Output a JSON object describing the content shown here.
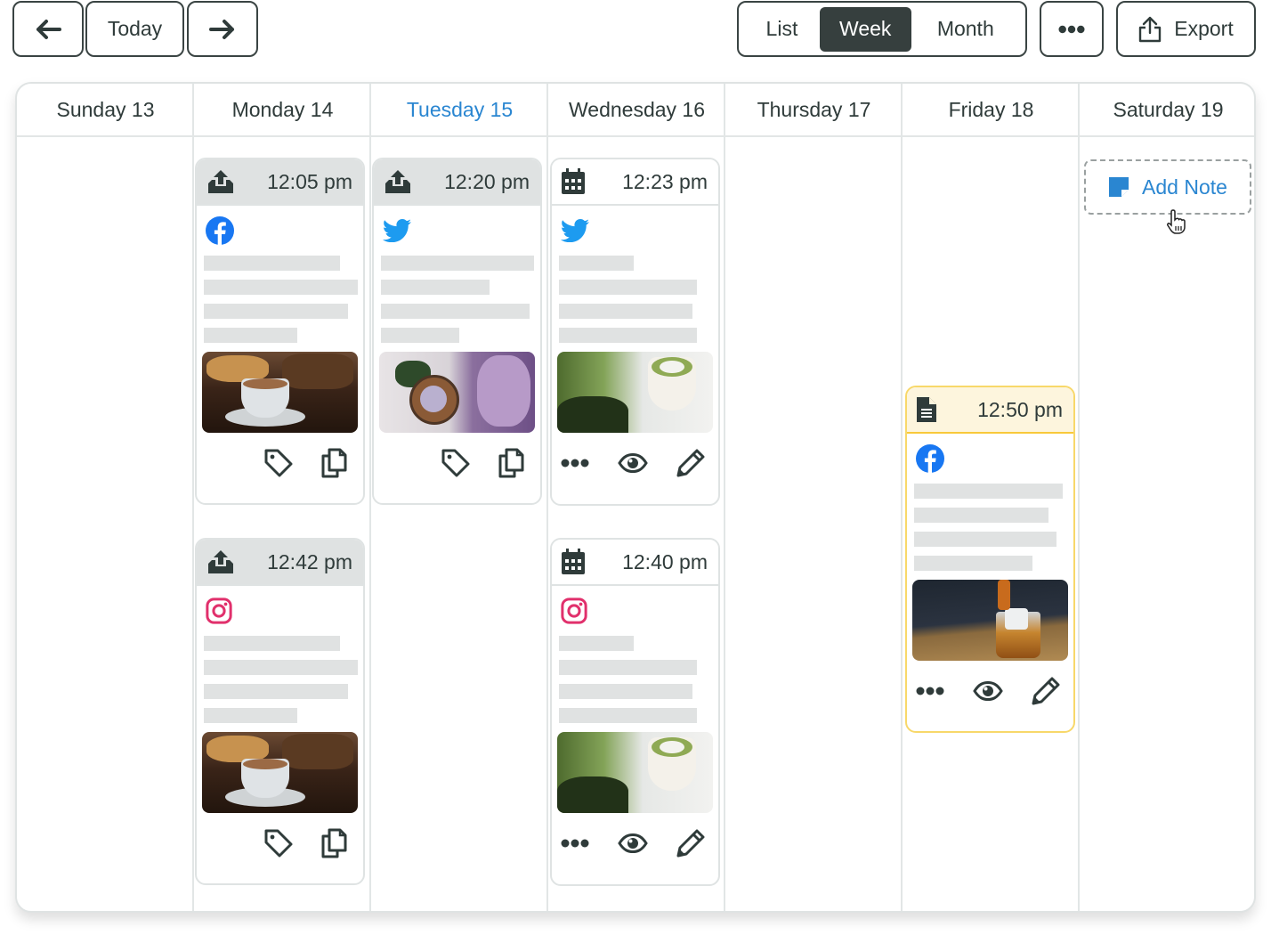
{
  "toolbar": {
    "prev_icon": "arrow-left-icon",
    "today_label": "Today",
    "next_icon": "arrow-right-icon",
    "views": [
      {
        "label": "List",
        "active": false
      },
      {
        "label": "Week",
        "active": true
      },
      {
        "label": "Month",
        "active": false
      }
    ],
    "more_icon": "ellipsis-icon",
    "export_label": "Export",
    "export_icon": "share-upload-icon"
  },
  "colors": {
    "accent": "#2a86d1",
    "dark": "#363f3e",
    "draft_border": "#f8c93a",
    "draft_header": "#fdf5dd",
    "published_header": "#dfe2e2",
    "facebook": "#1877f2",
    "twitter": "#1d9bf0",
    "instagram": "#e1306c"
  },
  "days": [
    {
      "label": "Sunday 13",
      "today": false
    },
    {
      "label": "Monday 14",
      "today": false
    },
    {
      "label": "Tuesday 15",
      "today": true
    },
    {
      "label": "Wednesday 16",
      "today": false
    },
    {
      "label": "Thursday 17",
      "today": false
    },
    {
      "label": "Friday 18",
      "today": false
    },
    {
      "label": "Saturday 19",
      "today": false
    }
  ],
  "posts": [
    {
      "day": "Monday 14",
      "time": "12:05 pm",
      "status": "published",
      "status_icon": "upload-tray-icon",
      "network": "facebook",
      "image": "cappuccino with pastries",
      "actions": [
        "tag",
        "copy"
      ]
    },
    {
      "day": "Monday 14",
      "time": "12:42 pm",
      "status": "published",
      "status_icon": "upload-tray-icon",
      "network": "instagram",
      "image": "cappuccino with pastries",
      "actions": [
        "tag",
        "copy"
      ]
    },
    {
      "day": "Tuesday 15",
      "time": "12:20 pm",
      "status": "published",
      "status_icon": "upload-tray-icon",
      "network": "twitter",
      "image": "lilac flowers and drink",
      "actions": [
        "tag",
        "copy"
      ]
    },
    {
      "day": "Wednesday 16",
      "time": "12:23 pm",
      "status": "scheduled",
      "status_icon": "calendar-icon",
      "network": "twitter",
      "image": "matcha latte with plant",
      "actions": [
        "more",
        "preview",
        "edit"
      ]
    },
    {
      "day": "Wednesday 16",
      "time": "12:40 pm",
      "status": "scheduled",
      "status_icon": "calendar-icon",
      "network": "instagram",
      "image": "matcha latte with plant",
      "actions": [
        "more",
        "preview",
        "edit"
      ]
    },
    {
      "day": "Friday 18",
      "time": "12:50 pm",
      "status": "draft",
      "status_icon": "document-icon",
      "network": "facebook",
      "image": "whiskey being poured",
      "actions": [
        "more",
        "preview",
        "edit"
      ]
    }
  ],
  "add_note": {
    "day": "Saturday 19",
    "label": "Add Note",
    "icon": "sticky-note-icon"
  }
}
